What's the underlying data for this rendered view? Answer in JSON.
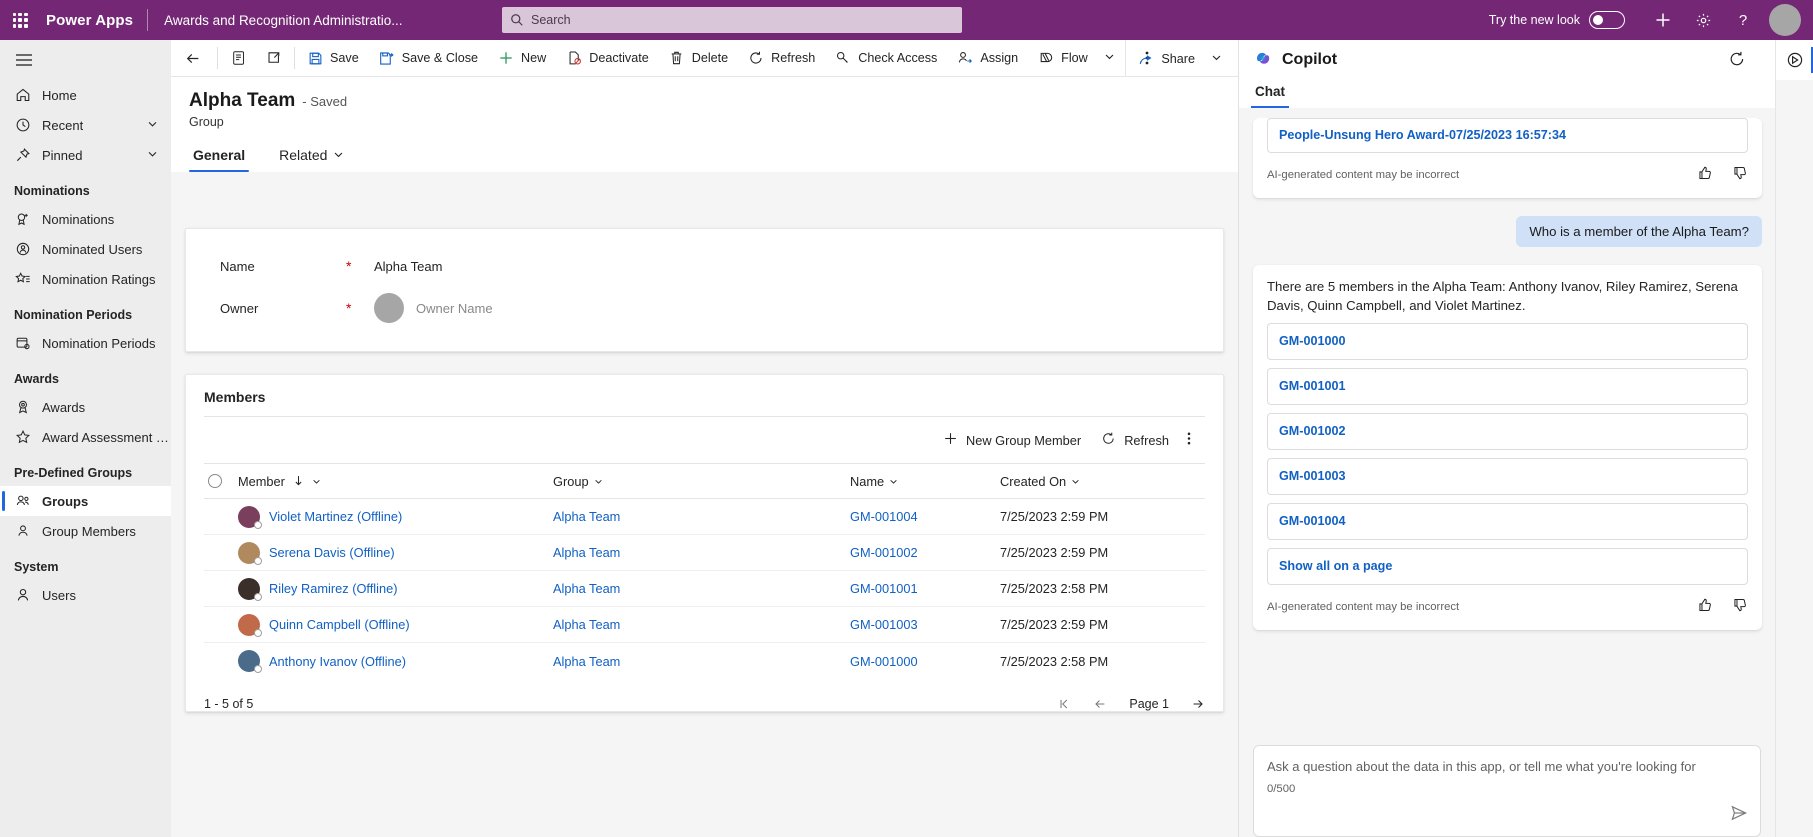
{
  "topbar": {
    "waffle_icon": "app-launcher-icon",
    "brand": "Power Apps",
    "app_name": "Awards and Recognition Administratio...",
    "search_placeholder": "Search",
    "search_value": "",
    "new_look_label": "Try the new look",
    "new_look_state": "off",
    "plus_icon": "add-icon",
    "gear_icon": "settings-gear-icon",
    "help_icon": "help-question-icon",
    "avatar_icon": "user-avatar"
  },
  "sidebar": {
    "hamburger_icon": "hamburger-menu-icon",
    "primary": [
      {
        "label": "Home",
        "icon": "home-icon",
        "chevron": false
      },
      {
        "label": "Recent",
        "icon": "clock-icon",
        "chevron": true
      },
      {
        "label": "Pinned",
        "icon": "pin-icon",
        "chevron": true
      }
    ],
    "groups": [
      {
        "title": "Nominations",
        "items": [
          {
            "label": "Nominations",
            "icon": "ribbon-add-icon"
          },
          {
            "label": "Nominated Users",
            "icon": "badge-person-icon"
          },
          {
            "label": "Nomination Ratings",
            "icon": "star-list-icon"
          }
        ]
      },
      {
        "title": "Nomination Periods",
        "items": [
          {
            "label": "Nomination Periods",
            "icon": "calendar-clock-icon"
          }
        ]
      },
      {
        "title": "Awards",
        "items": [
          {
            "label": "Awards",
            "icon": "award-medal-icon"
          },
          {
            "label": "Award Assessment R...",
            "icon": "star-icon"
          }
        ]
      },
      {
        "title": "Pre-Defined Groups",
        "items": [
          {
            "label": "Groups",
            "icon": "people-icon",
            "selected": true
          },
          {
            "label": "Group Members",
            "icon": "person-icon"
          }
        ]
      },
      {
        "title": "System",
        "items": [
          {
            "label": "Users",
            "icon": "person-outline-icon"
          }
        ]
      }
    ]
  },
  "commandbar": {
    "back_icon": "arrow-left-icon",
    "form_icon": "form-selector-icon",
    "popout_icon": "popout-icon",
    "buttons": [
      {
        "label": "Save",
        "icon": "save-floppy-icon"
      },
      {
        "label": "Save & Close",
        "icon": "save-close-icon"
      },
      {
        "label": "New",
        "icon": "plus-icon"
      },
      {
        "label": "Deactivate",
        "icon": "deactivate-icon"
      },
      {
        "label": "Delete",
        "icon": "trash-icon"
      },
      {
        "label": "Refresh",
        "icon": "refresh-icon"
      },
      {
        "label": "Check Access",
        "icon": "key-icon"
      },
      {
        "label": "Assign",
        "icon": "person-assign-icon"
      },
      {
        "label": "Flow",
        "icon": "flow-icon",
        "chevron": true
      }
    ],
    "overflow_icon": "more-vertical-icon",
    "share_label": "Share",
    "share_icon": "share-icon",
    "share_chevron": "chevron-down-icon"
  },
  "record": {
    "title": "Alpha Team",
    "saved_status": "- Saved",
    "entity": "Group",
    "tabs": [
      {
        "label": "General",
        "active": true,
        "chevron": false
      },
      {
        "label": "Related",
        "active": false,
        "chevron": true
      }
    ]
  },
  "form": {
    "fields": [
      {
        "label": "Name",
        "required": true,
        "value": "Alpha Team",
        "type": "text"
      },
      {
        "label": "Owner",
        "required": true,
        "value": "Owner Name",
        "type": "lookup"
      }
    ]
  },
  "members": {
    "section_title": "Members",
    "toolbar": [
      {
        "label": "New Group Member",
        "icon": "plus-icon"
      },
      {
        "label": "Refresh",
        "icon": "refresh-icon"
      }
    ],
    "overflow_icon": "more-vertical-icon",
    "select_all_icon": "select-all-circle-icon",
    "columns": [
      {
        "label": "Member",
        "sorted": true,
        "sort_dir": "asc"
      },
      {
        "label": "Group",
        "sorted": false
      },
      {
        "label": "Name",
        "sorted": false
      },
      {
        "label": "Created On",
        "sorted": false
      }
    ],
    "rows": [
      {
        "member": "Violet Martinez (Offline)",
        "avatar_color": "#7b3f5e",
        "group": "Alpha Team",
        "name": "GM-001004",
        "created": "7/25/2023 2:59 PM"
      },
      {
        "member": "Serena Davis (Offline)",
        "avatar_color": "#b08a5e",
        "group": "Alpha Team",
        "name": "GM-001002",
        "created": "7/25/2023 2:59 PM"
      },
      {
        "member": "Riley Ramirez (Offline)",
        "avatar_color": "#3b2f2a",
        "group": "Alpha Team",
        "name": "GM-001001",
        "created": "7/25/2023 2:58 PM"
      },
      {
        "member": "Quinn Campbell (Offline)",
        "avatar_color": "#c06a4a",
        "group": "Alpha Team",
        "name": "GM-001003",
        "created": "7/25/2023 2:59 PM"
      },
      {
        "member": "Anthony Ivanov (Offline)",
        "avatar_color": "#4a6b8a",
        "group": "Alpha Team",
        "name": "GM-001000",
        "created": "7/25/2023 2:58 PM"
      }
    ],
    "footer_count": "1 - 5 of 5",
    "page_label": "Page 1",
    "first_page_icon": "page-first-icon",
    "prev_page_icon": "chevron-left-icon",
    "next_page_icon": "arrow-right-icon"
  },
  "copilot": {
    "title": "Copilot",
    "logo_icon": "copilot-logo-icon",
    "refresh_icon": "refresh-history-icon",
    "rail_icon": "copilot-panel-icon",
    "tabs": [
      {
        "label": "Chat",
        "active": true
      }
    ],
    "messages": [
      {
        "role": "assistant",
        "partial": true,
        "citation": "People-Unsung Hero Award-07/25/2023 16:57:34",
        "ai_note": "AI-generated content may be incorrect",
        "thumb_up_icon": "thumbs-up-icon",
        "thumb_down_icon": "thumbs-down-icon"
      },
      {
        "role": "user",
        "text": "Who is a member of the Alpha Team?"
      },
      {
        "role": "assistant",
        "text": "There are 5 members in the Alpha Team: Anthony Ivanov, Riley Ramirez, Serena Davis, Quinn Campbell, and Violet Martinez.",
        "citations": [
          "GM-001000",
          "GM-001001",
          "GM-001002",
          "GM-001003",
          "GM-001004",
          "Show all on a page"
        ],
        "ai_note": "AI-generated content may be incorrect",
        "thumb_up_icon": "thumbs-up-icon",
        "thumb_down_icon": "thumbs-down-icon"
      }
    ],
    "compose_placeholder": "Ask a question about the data in this app, or tell me what you're looking for",
    "compose_value": "",
    "counter": "0/500",
    "send_icon": "send-icon"
  },
  "colors": {
    "brand_purple": "#742774",
    "accent_blue": "#2266E3",
    "link_blue": "#1160c4",
    "required_red": "#c00000"
  }
}
